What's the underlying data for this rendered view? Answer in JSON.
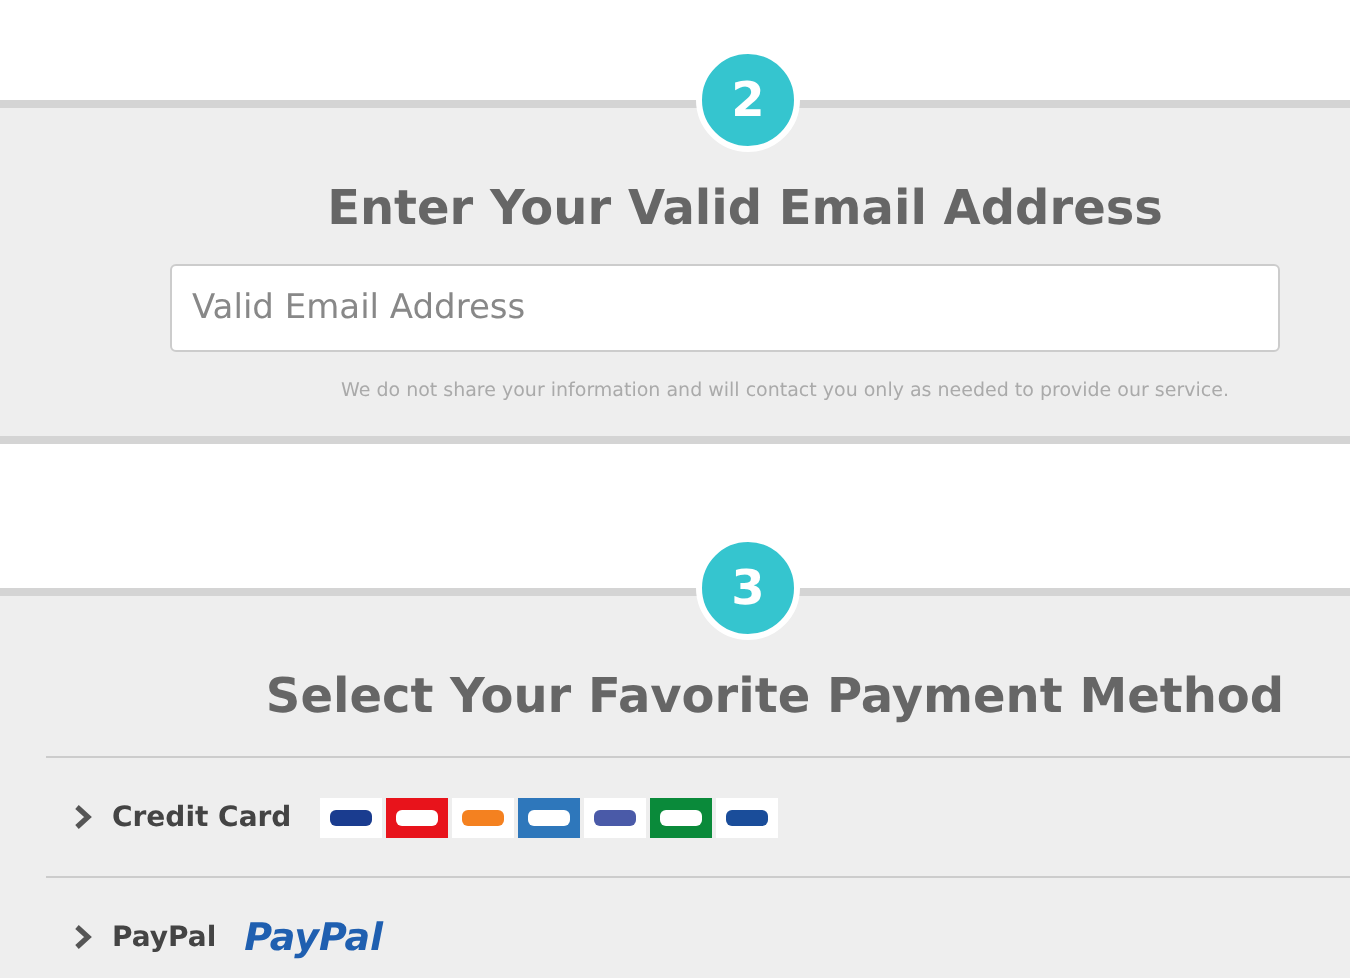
{
  "sections": [
    {
      "step": "2",
      "heading": "Enter Your Valid Email Address",
      "kind": "email",
      "field": {
        "placeholder": "Valid Email Address"
      },
      "note": "We do not share your information and will contact you only as needed to provide our service."
    },
    {
      "step": "3",
      "heading": "Select Your Favorite Payment Method",
      "kind": "payment",
      "methods": [
        {
          "label": "Credit Card",
          "logos": [
            {
              "kind": "card",
              "color": "#1a3c8f"
            },
            {
              "kind": "card",
              "color": "#e8131b"
            },
            {
              "kind": "card",
              "color": "#f48120"
            },
            {
              "kind": "card",
              "color": "#2e77bb"
            },
            {
              "kind": "card",
              "color": "#4a5aa8"
            },
            {
              "kind": "card",
              "color": "#0a8a3a"
            },
            {
              "kind": "card",
              "color": "#1a4d9a"
            }
          ]
        },
        {
          "label": "PayPal",
          "wordmark": "PayPal"
        }
      ]
    }
  ]
}
